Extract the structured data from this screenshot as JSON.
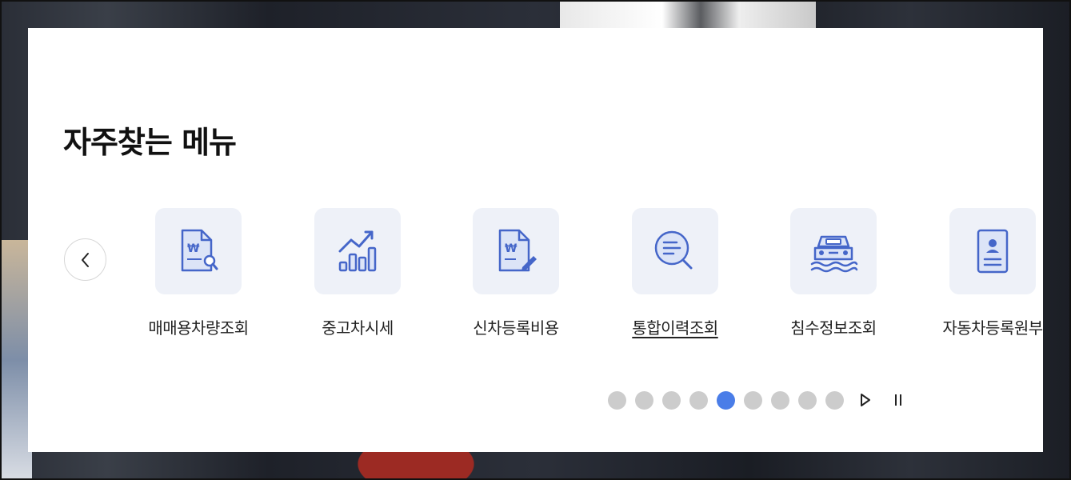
{
  "section": {
    "title": "자주찾는 메뉴"
  },
  "colors": {
    "accent": "#4a7de8",
    "icon_stroke": "#4566c9",
    "icon_bg": "#eef1f8",
    "dot_inactive": "#cccccc"
  },
  "menu": {
    "items": [
      {
        "label": "매매용차량조회",
        "icon": "won-document-search-icon"
      },
      {
        "label": "중고차시세",
        "icon": "chart-trend-up-icon"
      },
      {
        "label": "신차등록비용",
        "icon": "won-document-edit-icon"
      },
      {
        "label": "통합이력조회",
        "icon": "magnifier-list-icon",
        "active": true
      },
      {
        "label": "침수정보조회",
        "icon": "flooded-car-icon"
      },
      {
        "label": "자동차등록원부",
        "icon": "id-card-document-icon"
      }
    ]
  },
  "pagination": {
    "total_pages": 9,
    "current_page": 5
  },
  "controls": {
    "prev": "chevron-left-icon",
    "play": "play-icon",
    "pause": "pause-icon"
  }
}
